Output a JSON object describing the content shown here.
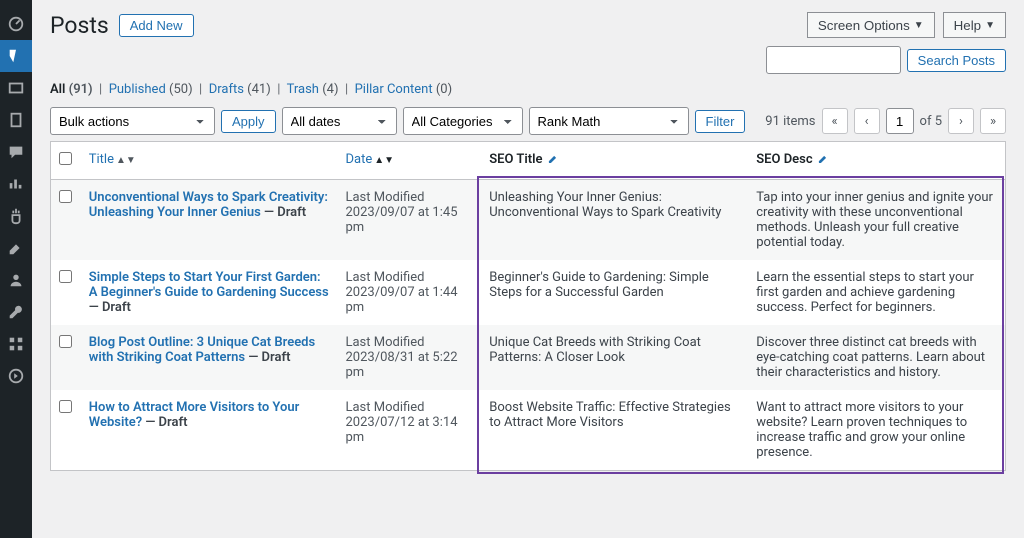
{
  "sidebar_icons": [
    "dashboard",
    "pin",
    "edit",
    "media",
    "comment",
    "chart",
    "wrench",
    "gear",
    "user",
    "tool",
    "grid",
    "play"
  ],
  "header": {
    "title": "Posts",
    "add_new": "Add New"
  },
  "top_controls": {
    "screen_options": "Screen Options",
    "help": "Help"
  },
  "filters": {
    "all": "All",
    "all_count": "(91)",
    "published": "Published",
    "published_count": "(50)",
    "drafts": "Drafts",
    "drafts_count": "(41)",
    "trash": "Trash",
    "trash_count": "(4)",
    "pillar": "Pillar Content",
    "pillar_count": "(0)"
  },
  "search": {
    "button": "Search Posts"
  },
  "tablenav": {
    "bulk": "Bulk actions",
    "apply": "Apply",
    "dates": "All dates",
    "cats": "All Categories",
    "rank": "Rank Math",
    "filter": "Filter"
  },
  "pagination": {
    "items": "91 items",
    "page": "1",
    "of": "of 5"
  },
  "columns": {
    "title": "Title",
    "date": "Date",
    "seo_title": "SEO Title",
    "seo_desc": "SEO Desc"
  },
  "rows": [
    {
      "title": "Unconventional Ways to Spark Creativity: Unleashing Your Inner Genius",
      "status": " — Draft",
      "date_label": "Last Modified",
      "date": "2023/09/07 at 1:45 pm",
      "seo_title": "Unleashing Your Inner Genius: Unconventional Ways to Spark Creativity",
      "seo_desc": "Tap into your inner genius and ignite your creativity with these unconventional methods. Unleash your full creative potential today."
    },
    {
      "title": "Simple Steps to Start Your First Garden: A Beginner's Guide to Gardening Success",
      "status": " — Draft",
      "date_label": "Last Modified",
      "date": "2023/09/07 at 1:44 pm",
      "seo_title": "Beginner's Guide to Gardening: Simple Steps for a Successful Garden",
      "seo_desc": "Learn the essential steps to start your first garden and achieve gardening success. Perfect for beginners."
    },
    {
      "title": "Blog Post Outline: 3 Unique Cat Breeds with Striking Coat Patterns",
      "status": " — Draft",
      "date_label": "Last Modified",
      "date": "2023/08/31 at 5:22 pm",
      "seo_title": "Unique Cat Breeds with Striking Coat Patterns: A Closer Look",
      "seo_desc": "Discover three distinct cat breeds with eye-catching coat patterns. Learn about their characteristics and history."
    },
    {
      "title": "How to Attract More Visitors to Your Website?",
      "status": " — Draft",
      "date_label": "Last Modified",
      "date": "2023/07/12 at 3:14 pm",
      "seo_title": "Boost Website Traffic: Effective Strategies to Attract More Visitors",
      "seo_desc": "Want to attract more visitors to your website? Learn proven techniques to increase traffic and grow your online presence."
    }
  ],
  "highlight_color": "#6b3fa0"
}
